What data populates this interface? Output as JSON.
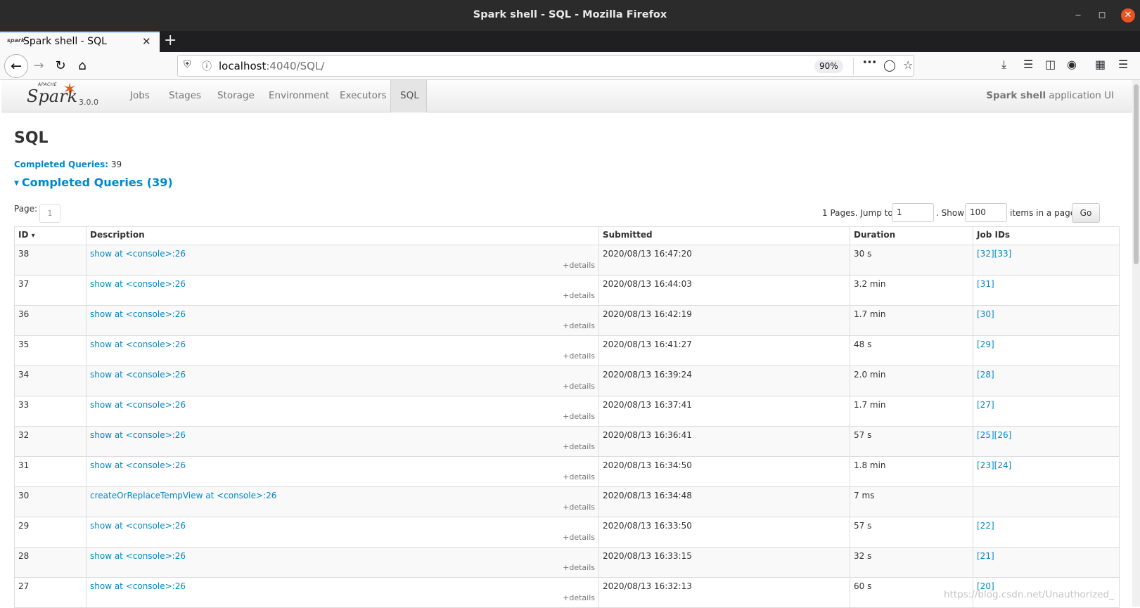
{
  "window": {
    "title": "Spark shell - SQL - Mozilla Firefox",
    "minimize": "‒",
    "maximize": "◻",
    "close": "✕"
  },
  "tab": {
    "title": "Spark shell - SQL",
    "favicon_text": "spark",
    "close": "✕"
  },
  "newtab": "+",
  "urlbar": {
    "host": "localhost",
    "rest": ":4040/SQL/",
    "zoom": "90%",
    "more": "•••"
  },
  "spark": {
    "apache": "APACHE",
    "word": "Spark",
    "version": "3.0.0",
    "nav": [
      "Jobs",
      "Stages",
      "Storage",
      "Environment",
      "Executors",
      "SQL"
    ],
    "app_name_bold": "Spark shell",
    "app_name_rest": " application UI"
  },
  "page": {
    "title": "SQL",
    "summary_label": "Completed Queries:",
    "summary_value": " 39",
    "section_title": "Completed Queries (39)"
  },
  "pager": {
    "page_label": "Page:",
    "page_value": "1",
    "pages_text": "1 Pages. Jump to",
    "jump_value": "1",
    "show_text": ". Show",
    "show_value": "100",
    "items_text": "items in a page.",
    "go": "Go"
  },
  "table": {
    "headers": [
      "ID",
      "Description",
      "Submitted",
      "Duration",
      "Job IDs"
    ],
    "sort_arrow": "▾",
    "details_label": "+details",
    "rows": [
      {
        "id": "38",
        "desc": "show at <console>:26",
        "submitted": "2020/08/13 16:47:20",
        "duration": "30 s",
        "jobs": "[32][33]"
      },
      {
        "id": "37",
        "desc": "show at <console>:26",
        "submitted": "2020/08/13 16:44:03",
        "duration": "3.2 min",
        "jobs": "[31]"
      },
      {
        "id": "36",
        "desc": "show at <console>:26",
        "submitted": "2020/08/13 16:42:19",
        "duration": "1.7 min",
        "jobs": "[30]"
      },
      {
        "id": "35",
        "desc": "show at <console>:26",
        "submitted": "2020/08/13 16:41:27",
        "duration": "48 s",
        "jobs": "[29]"
      },
      {
        "id": "34",
        "desc": "show at <console>:26",
        "submitted": "2020/08/13 16:39:24",
        "duration": "2.0 min",
        "jobs": "[28]"
      },
      {
        "id": "33",
        "desc": "show at <console>:26",
        "submitted": "2020/08/13 16:37:41",
        "duration": "1.7 min",
        "jobs": "[27]"
      },
      {
        "id": "32",
        "desc": "show at <console>:26",
        "submitted": "2020/08/13 16:36:41",
        "duration": "57 s",
        "jobs": "[25][26]"
      },
      {
        "id": "31",
        "desc": "show at <console>:26",
        "submitted": "2020/08/13 16:34:50",
        "duration": "1.8 min",
        "jobs": "[23][24]"
      },
      {
        "id": "30",
        "desc": "createOrReplaceTempView at <console>:26",
        "submitted": "2020/08/13 16:34:48",
        "duration": "7 ms",
        "jobs": ""
      },
      {
        "id": "29",
        "desc": "show at <console>:26",
        "submitted": "2020/08/13 16:33:50",
        "duration": "57 s",
        "jobs": "[22]"
      },
      {
        "id": "28",
        "desc": "show at <console>:26",
        "submitted": "2020/08/13 16:33:15",
        "duration": "32 s",
        "jobs": "[21]"
      },
      {
        "id": "27",
        "desc": "show at <console>:26",
        "submitted": "2020/08/13 16:32:13",
        "duration": "60 s",
        "jobs": "[20]"
      }
    ]
  },
  "watermark": "https://blog.csdn.net/Unauthorized_"
}
